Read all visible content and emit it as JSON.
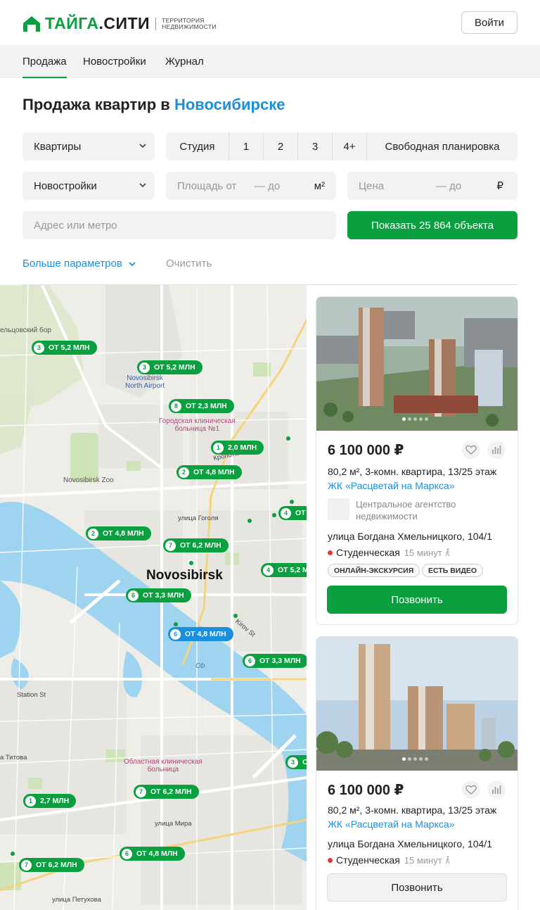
{
  "header": {
    "logo_main": "ТАЙГА",
    "logo_dot": ".",
    "logo_second": "СИТИ",
    "logo_sub": "ТЕРРИТОРИЯ НЕДВИЖИМОСТИ",
    "login_label": "Войти"
  },
  "nav": {
    "items": [
      "Продажа",
      "Новостройки",
      "Журнал"
    ],
    "active": "Продажа"
  },
  "title": {
    "prefix": "Продажа квартир в ",
    "city": "Новосибирске"
  },
  "filters": {
    "type_select": "Квартиры",
    "rooms": [
      "Студия",
      "1",
      "2",
      "3",
      "4+",
      "Свободная планировка"
    ],
    "market_select": "Новостройки",
    "area_from_placeholder": "Площадь от",
    "area_to_placeholder": "— до",
    "area_unit": "м²",
    "price_placeholder": "Цена",
    "price_to_placeholder": "— до",
    "price_unit": "₽",
    "address_placeholder": "Адрес или метро",
    "show_button": "Показать 25 864 объекта",
    "more_params": "Больше параметров",
    "clear": "Очистить"
  },
  "map": {
    "city_label": "Novosibirsk",
    "labels": {
      "forest": "ельцовский бор",
      "airport_1": "Novosibirsk",
      "airport_2": "North Airport",
      "hospital1_1": "Городская клиническая",
      "hospital1_2": "больница №1",
      "zoo": "Novosibirsk Zoo",
      "kropotkina": "Кропоткина",
      "gogolya": "улица Гоголя",
      "kirov": "Kirov St",
      "ob": "Ob",
      "station": "Station St",
      "titova": "а Титова",
      "hospital2_1": "Областная клиническая",
      "hospital2_2": "больница",
      "mira": "улица Мира",
      "petukhova": "улица Петухова"
    },
    "pins": [
      {
        "n": "3",
        "text": "ОТ 5,2 МЛН",
        "color": "green"
      },
      {
        "n": "3",
        "text": "ОТ 5,2 МЛН",
        "color": "green"
      },
      {
        "n": "8",
        "text": "ОТ 2,3 МЛН",
        "color": "green"
      },
      {
        "n": "1",
        "text": "2,0 МЛН",
        "color": "green"
      },
      {
        "n": "2",
        "text": "ОТ 4,8 МЛН",
        "color": "green"
      },
      {
        "n": "4",
        "text": "ОТ",
        "color": "green"
      },
      {
        "n": "2",
        "text": "ОТ 4,8 МЛН",
        "color": "green"
      },
      {
        "n": "7",
        "text": "ОТ 6,2 МЛН",
        "color": "green"
      },
      {
        "n": "4",
        "text": "ОТ 5,2 МЛН",
        "color": "green"
      },
      {
        "n": "6",
        "text": "ОТ 3,3 МЛН",
        "color": "green"
      },
      {
        "n": "6",
        "text": "ОТ 4,8 МЛН",
        "color": "blue"
      },
      {
        "n": "6",
        "text": "ОТ 3,3 МЛН",
        "color": "green"
      },
      {
        "n": "3",
        "text": "О",
        "color": "green"
      },
      {
        "n": "1",
        "text": "2,7 МЛН",
        "color": "green"
      },
      {
        "n": "7",
        "text": "ОТ 6,2 МЛН",
        "color": "green"
      },
      {
        "n": "6",
        "text": "ОТ 4,8 МЛН",
        "color": "green"
      },
      {
        "n": "7",
        "text": "ОТ 6,2 МЛН",
        "color": "green"
      }
    ]
  },
  "listings": [
    {
      "price": "6 100 000 ₽",
      "desc": "80,2 м², 3-комн. квартира, 13/25 этаж",
      "complex": "ЖК «Расцветай на Маркса»",
      "agency": "Центральное агентство недвижимости",
      "address": "улица Богдана Хмельницкого, 104/1",
      "metro": "Студенческая",
      "metro_time": "15 минут",
      "tags": [
        "ОНЛАЙН-ЭКСКУРСИЯ",
        "ЕСТЬ ВИДЕО"
      ],
      "call": "Позвонить"
    },
    {
      "price": "6 100 000 ₽",
      "desc": "80,2 м², 3-комн. квартира, 13/25 этаж",
      "complex": "ЖК «Расцветай на Маркса»",
      "address": "улица Богдана Хмельницкого, 104/1",
      "metro": "Студенческая",
      "metro_time": "15 минут",
      "call": "Позвонить"
    }
  ],
  "colors": {
    "brand_green": "#0aa040",
    "link_blue": "#1a8fdd",
    "metro_red": "#e53935"
  }
}
